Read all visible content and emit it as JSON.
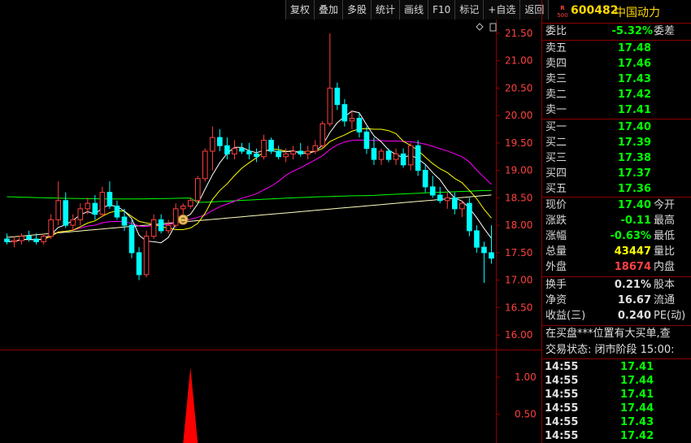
{
  "toolbar": {
    "buttons": [
      "复权",
      "叠加",
      "多股",
      "统计",
      "画线",
      "F10",
      "标记",
      "+自选",
      "返回"
    ]
  },
  "stock": {
    "market_badge_top": "R",
    "market_badge_bottom": "500",
    "code": "600482",
    "name": "中国动力"
  },
  "quote": {
    "weibi_label": "委比",
    "weibi_value": "-5.32%",
    "weicha_label": "委差",
    "asks": [
      {
        "label": "卖五",
        "price": "17.48"
      },
      {
        "label": "卖四",
        "price": "17.46"
      },
      {
        "label": "卖三",
        "price": "17.43"
      },
      {
        "label": "卖二",
        "price": "17.42"
      },
      {
        "label": "卖一",
        "price": "17.41"
      }
    ],
    "bids": [
      {
        "label": "买一",
        "price": "17.40"
      },
      {
        "label": "买二",
        "price": "17.39"
      },
      {
        "label": "买三",
        "price": "17.38"
      },
      {
        "label": "买四",
        "price": "17.37"
      },
      {
        "label": "买五",
        "price": "17.36"
      }
    ],
    "stats": [
      {
        "label": "现价",
        "value": "17.40",
        "label2": "今开"
      },
      {
        "label": "涨跌",
        "value": "-0.11",
        "label2": "最高"
      },
      {
        "label": "涨幅",
        "value": "-0.63%",
        "label2": "最低"
      },
      {
        "label": "总量",
        "value": "43447",
        "label2": "量比"
      },
      {
        "label": "外盘",
        "value": "18674",
        "label2": "内盘"
      }
    ],
    "fundamentals": [
      {
        "label": "换手",
        "value": "0.21%",
        "label2": "股本"
      },
      {
        "label": "净资",
        "value": "16.67",
        "label2": "流通"
      },
      {
        "label": "收益(三)",
        "value": "0.240",
        "label2": "PE(动)"
      }
    ],
    "message": "在买盘***位置有大买单,查",
    "status": "交易状态: 闭市阶段  15:00:"
  },
  "ticks": [
    {
      "time": "14:55",
      "price": "17.41"
    },
    {
      "time": "14:55",
      "price": "17.44"
    },
    {
      "time": "14:55",
      "price": "17.41"
    },
    {
      "time": "14:55",
      "price": "17.44"
    },
    {
      "time": "14:55",
      "price": "17.43"
    },
    {
      "time": "14:55",
      "price": "17.42"
    }
  ],
  "colors": {
    "up": "#ff4040",
    "down": "#00ffff",
    "ma5": "#ffffff",
    "ma10": "#ffff00",
    "ma20": "#ff00ff",
    "ma60": "#00ff00",
    "ma120": "#ffffc0",
    "grid": "#8b0000"
  },
  "chart_data": {
    "type": "candlestick",
    "y_ticks": [
      "21.50",
      "21.00",
      "20.50",
      "20.00",
      "19.50",
      "19.00",
      "18.50",
      "18.00",
      "17.50",
      "17.00",
      "16.50",
      "16.00"
    ],
    "ylim": [
      15.75,
      21.75
    ],
    "indicator_ticks": [
      "1.00",
      "0.50"
    ],
    "candles": [
      [
        17.75,
        17.85,
        17.65,
        17.7
      ],
      [
        17.7,
        17.8,
        17.6,
        17.72
      ],
      [
        17.72,
        17.85,
        17.65,
        17.8
      ],
      [
        17.8,
        17.9,
        17.7,
        17.75
      ],
      [
        17.75,
        17.85,
        17.65,
        17.7
      ],
      [
        17.7,
        17.85,
        17.65,
        17.8
      ],
      [
        17.8,
        18.2,
        17.75,
        18.1
      ],
      [
        18.1,
        18.8,
        18.0,
        18.45
      ],
      [
        18.45,
        18.6,
        17.95,
        18.0
      ],
      [
        18.0,
        18.2,
        17.9,
        18.1
      ],
      [
        18.1,
        18.4,
        18.0,
        18.3
      ],
      [
        18.3,
        18.5,
        18.2,
        18.4
      ],
      [
        18.4,
        18.55,
        18.1,
        18.2
      ],
      [
        18.2,
        18.7,
        18.15,
        18.6
      ],
      [
        18.6,
        18.8,
        18.3,
        18.35
      ],
      [
        18.35,
        18.45,
        18.1,
        18.15
      ],
      [
        18.15,
        18.3,
        17.9,
        18.0
      ],
      [
        18.0,
        18.1,
        17.4,
        17.5
      ],
      [
        17.5,
        17.6,
        17.0,
        17.1
      ],
      [
        17.1,
        17.9,
        17.05,
        17.8
      ],
      [
        17.8,
        18.2,
        17.75,
        18.1
      ],
      [
        18.1,
        18.2,
        17.85,
        17.9
      ],
      [
        17.9,
        18.1,
        17.85,
        18.0
      ],
      [
        18.0,
        18.4,
        17.95,
        18.3
      ],
      [
        18.3,
        18.4,
        18.2,
        18.35
      ],
      [
        18.35,
        18.5,
        18.3,
        18.45
      ],
      [
        18.45,
        18.9,
        18.4,
        18.85
      ],
      [
        18.85,
        19.4,
        18.8,
        19.35
      ],
      [
        19.35,
        19.8,
        19.0,
        19.6
      ],
      [
        19.6,
        19.75,
        19.35,
        19.45
      ],
      [
        19.45,
        19.6,
        19.2,
        19.3
      ],
      [
        19.3,
        19.55,
        19.2,
        19.4
      ],
      [
        19.4,
        19.5,
        19.3,
        19.35
      ],
      [
        19.35,
        19.5,
        19.2,
        19.3
      ],
      [
        19.3,
        19.4,
        19.15,
        19.25
      ],
      [
        19.25,
        19.65,
        19.2,
        19.55
      ],
      [
        19.55,
        19.6,
        19.3,
        19.35
      ],
      [
        19.35,
        19.45,
        19.2,
        19.25
      ],
      [
        19.25,
        19.4,
        19.15,
        19.3
      ],
      [
        19.3,
        19.45,
        19.2,
        19.35
      ],
      [
        19.35,
        19.5,
        19.25,
        19.3
      ],
      [
        19.3,
        19.45,
        19.2,
        19.35
      ],
      [
        19.35,
        19.55,
        19.3,
        19.45
      ],
      [
        19.45,
        19.9,
        19.4,
        19.85
      ],
      [
        19.85,
        21.5,
        19.8,
        20.5
      ],
      [
        20.5,
        20.6,
        20.1,
        20.2
      ],
      [
        20.2,
        20.3,
        19.8,
        19.9
      ],
      [
        19.9,
        20.1,
        19.75,
        19.95
      ],
      [
        19.95,
        20.05,
        19.6,
        19.7
      ],
      [
        19.7,
        19.8,
        19.3,
        19.4
      ],
      [
        19.4,
        19.6,
        19.1,
        19.2
      ],
      [
        19.2,
        19.4,
        19.1,
        19.35
      ],
      [
        19.35,
        19.4,
        19.15,
        19.2
      ],
      [
        19.2,
        19.4,
        19.1,
        19.3
      ],
      [
        19.3,
        19.4,
        19.05,
        19.1
      ],
      [
        19.1,
        19.5,
        19.0,
        19.45
      ],
      [
        19.45,
        19.55,
        18.9,
        19.0
      ],
      [
        19.0,
        19.1,
        18.6,
        18.7
      ],
      [
        18.7,
        18.9,
        18.5,
        18.55
      ],
      [
        18.55,
        18.7,
        18.4,
        18.45
      ],
      [
        18.45,
        18.6,
        18.3,
        18.5
      ],
      [
        18.5,
        18.6,
        18.2,
        18.3
      ],
      [
        18.3,
        18.45,
        18.15,
        18.4
      ],
      [
        18.4,
        18.5,
        17.8,
        17.9
      ],
      [
        17.9,
        18.0,
        17.5,
        17.6
      ],
      [
        17.6,
        17.7,
        16.95,
        17.5
      ],
      [
        17.5,
        18.0,
        17.3,
        17.4
      ]
    ]
  }
}
